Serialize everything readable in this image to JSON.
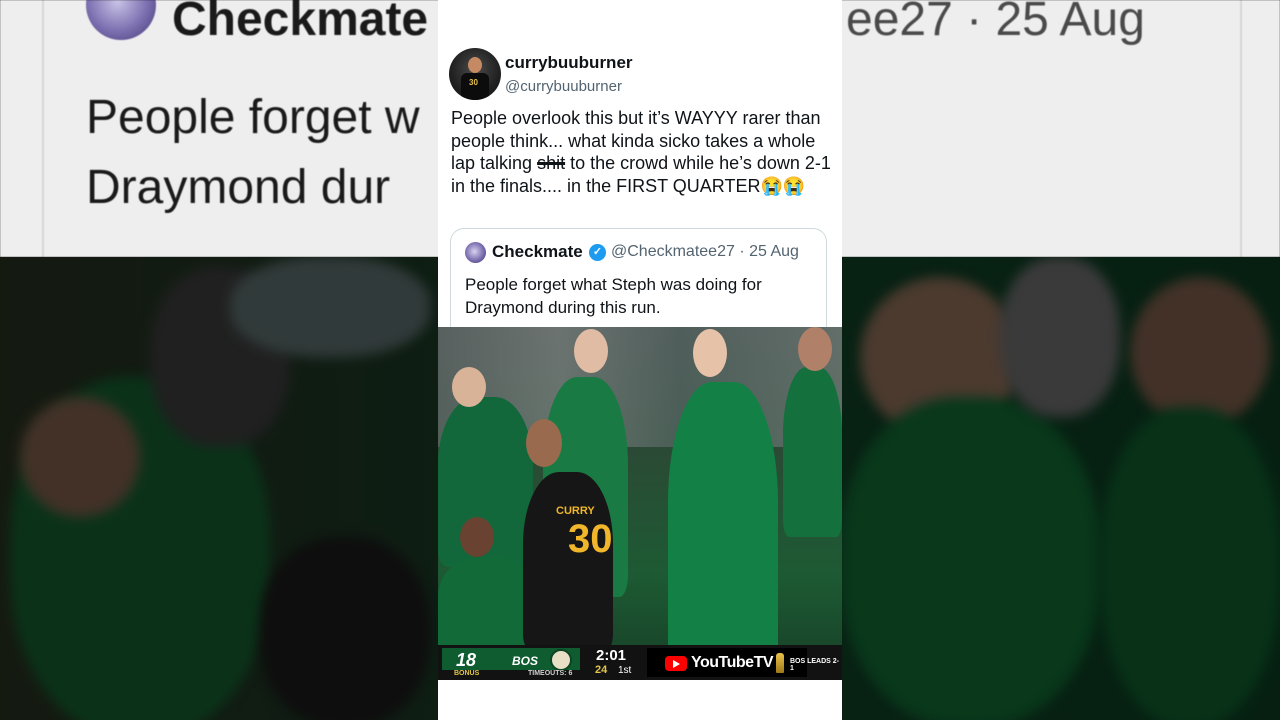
{
  "background": {
    "top_name": "Checkmate",
    "top_handle": "ee27 · 25 Aug",
    "top_line1": "People forget w          doing for",
    "top_line2": "Draymond dur"
  },
  "tweet": {
    "author_name": "currybuuburner",
    "author_handle": "@currybuuburner",
    "text_before": "People overlook this but it’s WAYYY rarer than people think... what kinda sicko takes a whole lap talking ",
    "text_struck": "shit",
    "text_after": " to the crowd while he’s down 2-1 in the finals.... in the FIRST QUARTER😭😭"
  },
  "quoted_tweet": {
    "author_name": "Checkmate",
    "verified_mark": "✓",
    "author_handle": "@Checkmatee27",
    "date": "25 Aug",
    "separator": "·",
    "text": "People forget what Steph was doing for Draymond during this run."
  },
  "video": {
    "jersey_name": "CURRY",
    "jersey_number": "30",
    "scorebug": {
      "score": "18",
      "team": "BOS",
      "bonus": "BONUS",
      "timeouts": "TIMEOUTS: 6",
      "clock": "2:01",
      "shot_clock": "24",
      "period": "1st",
      "broadcaster": "YouTubeTV",
      "series": "BOS LEADS 2-1"
    }
  }
}
